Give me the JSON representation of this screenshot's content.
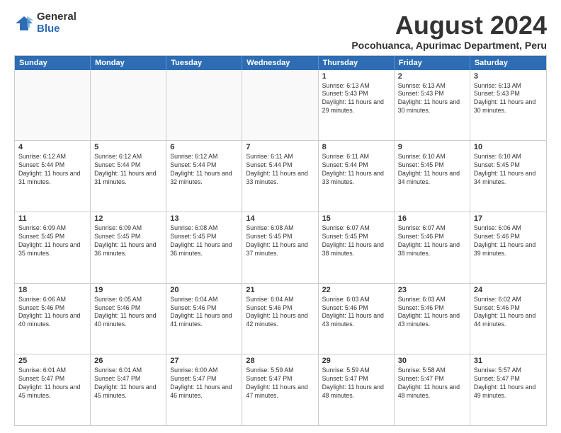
{
  "logo": {
    "general": "General",
    "blue": "Blue"
  },
  "title": "August 2024",
  "subtitle": "Pocohuanca, Apurimac Department, Peru",
  "days_of_week": [
    "Sunday",
    "Monday",
    "Tuesday",
    "Wednesday",
    "Thursday",
    "Friday",
    "Saturday"
  ],
  "weeks": [
    [
      {
        "day": "",
        "info": ""
      },
      {
        "day": "",
        "info": ""
      },
      {
        "day": "",
        "info": ""
      },
      {
        "day": "",
        "info": ""
      },
      {
        "day": "1",
        "info": "Sunrise: 6:13 AM\nSunset: 5:43 PM\nDaylight: 11 hours and 29 minutes."
      },
      {
        "day": "2",
        "info": "Sunrise: 6:13 AM\nSunset: 5:43 PM\nDaylight: 11 hours and 30 minutes."
      },
      {
        "day": "3",
        "info": "Sunrise: 6:13 AM\nSunset: 5:43 PM\nDaylight: 11 hours and 30 minutes."
      }
    ],
    [
      {
        "day": "4",
        "info": "Sunrise: 6:12 AM\nSunset: 5:44 PM\nDaylight: 11 hours and 31 minutes."
      },
      {
        "day": "5",
        "info": "Sunrise: 6:12 AM\nSunset: 5:44 PM\nDaylight: 11 hours and 31 minutes."
      },
      {
        "day": "6",
        "info": "Sunrise: 6:12 AM\nSunset: 5:44 PM\nDaylight: 11 hours and 32 minutes."
      },
      {
        "day": "7",
        "info": "Sunrise: 6:11 AM\nSunset: 5:44 PM\nDaylight: 11 hours and 33 minutes."
      },
      {
        "day": "8",
        "info": "Sunrise: 6:11 AM\nSunset: 5:44 PM\nDaylight: 11 hours and 33 minutes."
      },
      {
        "day": "9",
        "info": "Sunrise: 6:10 AM\nSunset: 5:45 PM\nDaylight: 11 hours and 34 minutes."
      },
      {
        "day": "10",
        "info": "Sunrise: 6:10 AM\nSunset: 5:45 PM\nDaylight: 11 hours and 34 minutes."
      }
    ],
    [
      {
        "day": "11",
        "info": "Sunrise: 6:09 AM\nSunset: 5:45 PM\nDaylight: 11 hours and 35 minutes."
      },
      {
        "day": "12",
        "info": "Sunrise: 6:09 AM\nSunset: 5:45 PM\nDaylight: 11 hours and 36 minutes."
      },
      {
        "day": "13",
        "info": "Sunrise: 6:08 AM\nSunset: 5:45 PM\nDaylight: 11 hours and 36 minutes."
      },
      {
        "day": "14",
        "info": "Sunrise: 6:08 AM\nSunset: 5:45 PM\nDaylight: 11 hours and 37 minutes."
      },
      {
        "day": "15",
        "info": "Sunrise: 6:07 AM\nSunset: 5:45 PM\nDaylight: 11 hours and 38 minutes."
      },
      {
        "day": "16",
        "info": "Sunrise: 6:07 AM\nSunset: 5:46 PM\nDaylight: 11 hours and 38 minutes."
      },
      {
        "day": "17",
        "info": "Sunrise: 6:06 AM\nSunset: 5:46 PM\nDaylight: 11 hours and 39 minutes."
      }
    ],
    [
      {
        "day": "18",
        "info": "Sunrise: 6:06 AM\nSunset: 5:46 PM\nDaylight: 11 hours and 40 minutes."
      },
      {
        "day": "19",
        "info": "Sunrise: 6:05 AM\nSunset: 5:46 PM\nDaylight: 11 hours and 40 minutes."
      },
      {
        "day": "20",
        "info": "Sunrise: 6:04 AM\nSunset: 5:46 PM\nDaylight: 11 hours and 41 minutes."
      },
      {
        "day": "21",
        "info": "Sunrise: 6:04 AM\nSunset: 5:46 PM\nDaylight: 11 hours and 42 minutes."
      },
      {
        "day": "22",
        "info": "Sunrise: 6:03 AM\nSunset: 5:46 PM\nDaylight: 11 hours and 43 minutes."
      },
      {
        "day": "23",
        "info": "Sunrise: 6:03 AM\nSunset: 5:46 PM\nDaylight: 11 hours and 43 minutes."
      },
      {
        "day": "24",
        "info": "Sunrise: 6:02 AM\nSunset: 5:46 PM\nDaylight: 11 hours and 44 minutes."
      }
    ],
    [
      {
        "day": "25",
        "info": "Sunrise: 6:01 AM\nSunset: 5:47 PM\nDaylight: 11 hours and 45 minutes."
      },
      {
        "day": "26",
        "info": "Sunrise: 6:01 AM\nSunset: 5:47 PM\nDaylight: 11 hours and 45 minutes."
      },
      {
        "day": "27",
        "info": "Sunrise: 6:00 AM\nSunset: 5:47 PM\nDaylight: 11 hours and 46 minutes."
      },
      {
        "day": "28",
        "info": "Sunrise: 5:59 AM\nSunset: 5:47 PM\nDaylight: 11 hours and 47 minutes."
      },
      {
        "day": "29",
        "info": "Sunrise: 5:59 AM\nSunset: 5:47 PM\nDaylight: 11 hours and 48 minutes."
      },
      {
        "day": "30",
        "info": "Sunrise: 5:58 AM\nSunset: 5:47 PM\nDaylight: 11 hours and 48 minutes."
      },
      {
        "day": "31",
        "info": "Sunrise: 5:57 AM\nSunset: 5:47 PM\nDaylight: 11 hours and 49 minutes."
      }
    ]
  ]
}
